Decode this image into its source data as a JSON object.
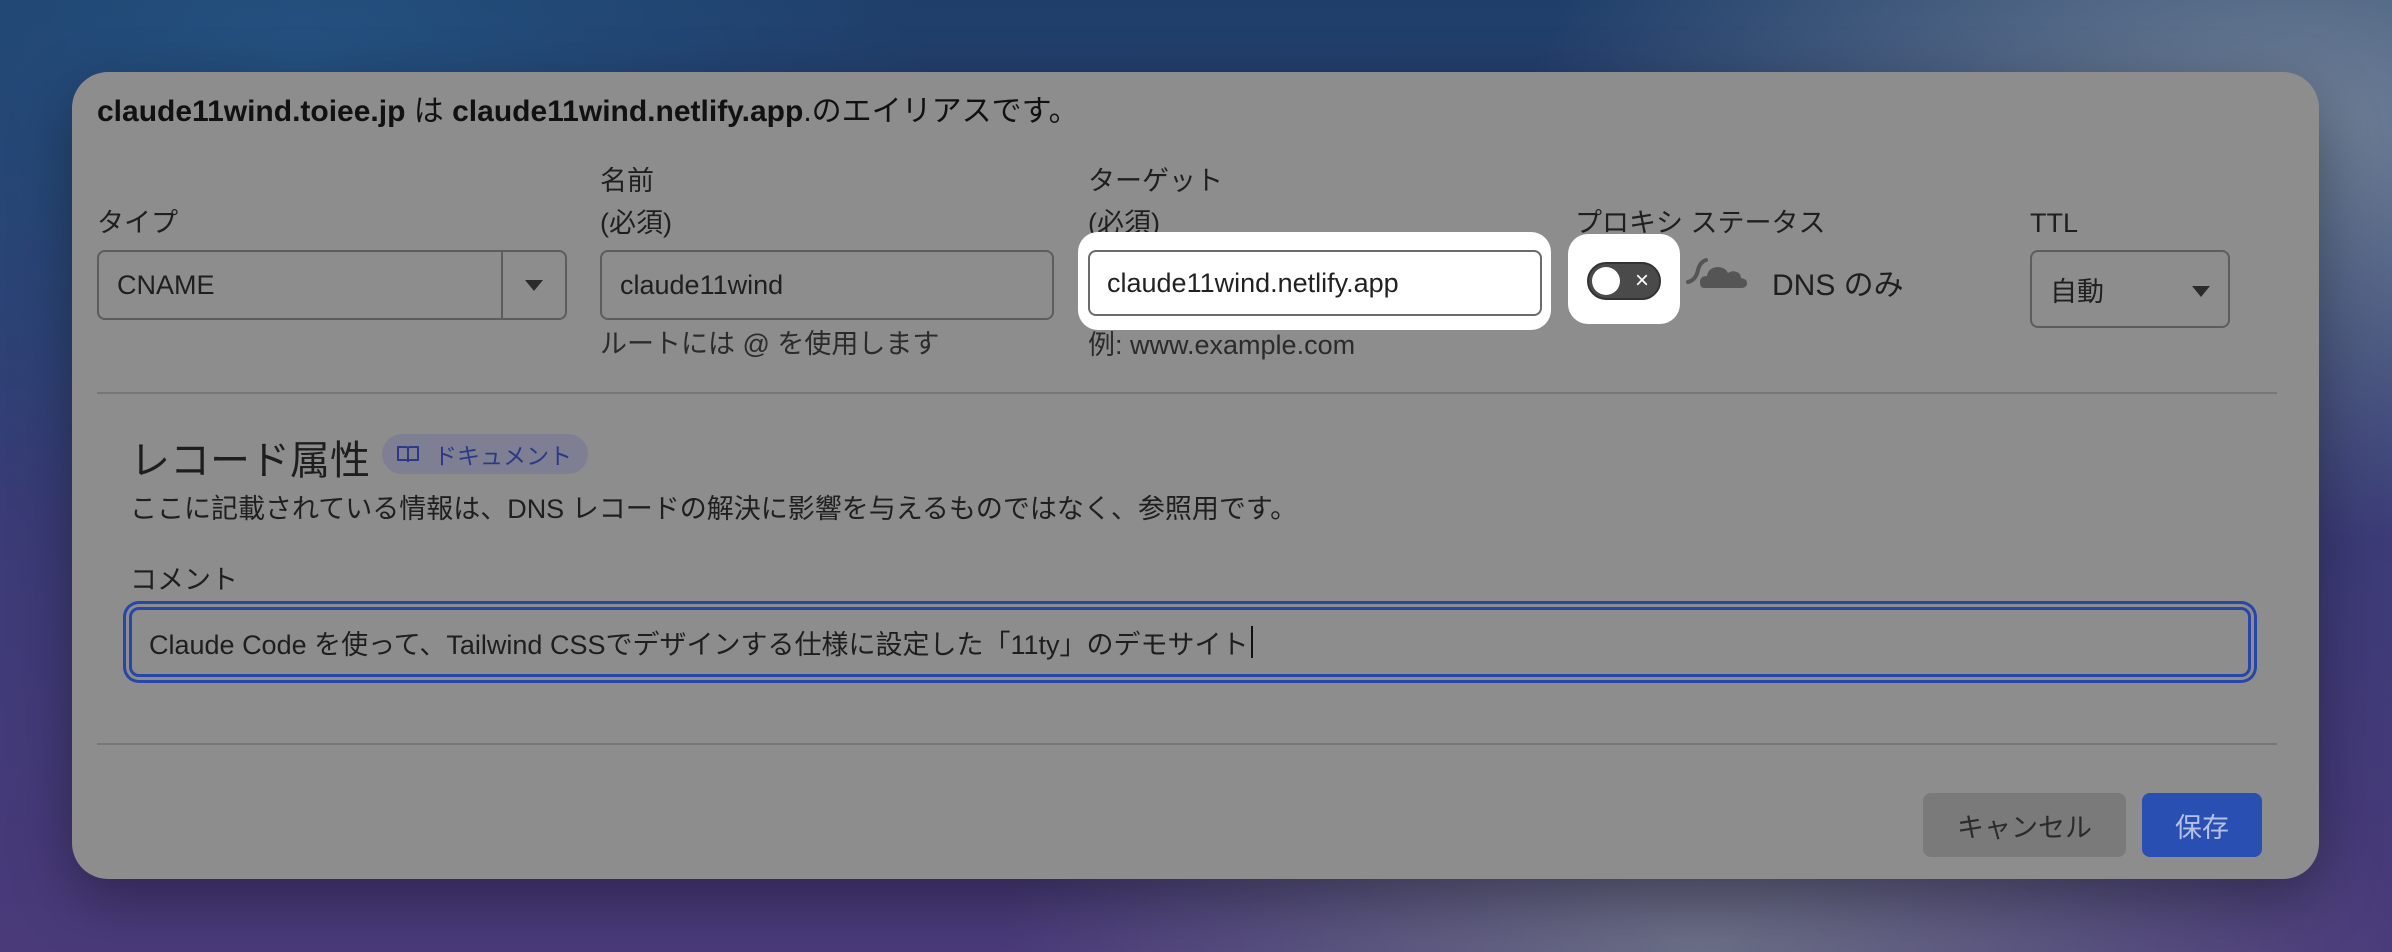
{
  "alias": {
    "source_host": "claude11wind.toiee.jp",
    "particle": " は ",
    "target_host": "claude11wind.netlify.app",
    "suffix": ".のエイリアスです。"
  },
  "type_field": {
    "label": "タイプ",
    "value": "CNAME"
  },
  "name_field": {
    "label": "名前",
    "required": "(必須)",
    "value": "claude11wind",
    "hint": "ルートには @ を使用します"
  },
  "target_field": {
    "label": "ターゲット",
    "required": "(必須)",
    "value": "claude11wind.netlify.app",
    "hint": "例: www.example.com"
  },
  "proxy": {
    "label": "プロキシ ステータス",
    "toggle_state": "off",
    "status_text": "DNS のみ"
  },
  "ttl": {
    "label": "TTL",
    "value": "自動"
  },
  "record_attributes": {
    "title": "レコード属性",
    "doc_badge": "ドキュメント",
    "description": "ここに記載されている情報は、DNS レコードの解決に影響を与えるものではなく、参照用です。",
    "comment_label": "コメント",
    "comment_value": "Claude Code を使って、Tailwind CSSでデザインする仕様に設定した「11ty」のデモサイト"
  },
  "actions": {
    "cancel": "キャンセル",
    "save": "保存"
  },
  "colors": {
    "panel": "#8d8d8d",
    "accent": "#2a4fb2",
    "focus_ring": "#2846a8"
  }
}
